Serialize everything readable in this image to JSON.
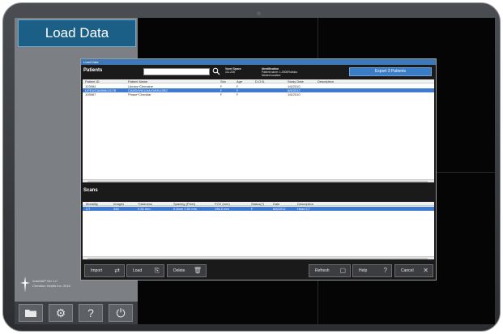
{
  "sidebar": {
    "title": "Load Data",
    "logo_text": [
      "AutoMAP Ver 1.0",
      "Chevillon Health Inc. 2016"
    ]
  },
  "dialog": {
    "title": "Load Data",
    "patients_title": "Patients",
    "search_value": "",
    "info_left": [
      "Voxel Space",
      "111-226"
    ],
    "info_right": [
      "Identification",
      "Patient name: 1-0000Roboko",
      "Nested location"
    ],
    "export_label": "Export 3 Patients",
    "patient_columns": [
      "Patient ID",
      "Patient Name",
      "Sex",
      "Age",
      "D.O.B.",
      "Study Date",
      "Description"
    ],
    "patients": [
      [
        "103984",
        "Library^Clemaine",
        "F",
        "F",
        "",
        "1/6/2010",
        ""
      ],
      [
        "LIFE4/CAM9/6/1/C78",
        "CAHD/9/6/1/AA/G/B91/3R2",
        "F",
        "F",
        "",
        "6/6/2012",
        ""
      ],
      [
        "105587",
        "Phase^Cheddar",
        "F",
        "F",
        "",
        "1/6/2010",
        ""
      ]
    ],
    "selected_patient": 1,
    "scans_title": "Scans",
    "scan_columns": [
      "Modality",
      "Images",
      "Thickness",
      "Spacing (Pixel)",
      "FOV (mm)",
      "Status(?)",
      "Date",
      "Description"
    ],
    "scans": [
      [
        "CT",
        "346",
        "0.50 mm",
        "0.5mm 0.50 mm",
        "196.0 mm",
        "F",
        "6/6/2012",
        "Head CT"
      ]
    ],
    "selected_scan": 0,
    "toolbar": {
      "import": "Import",
      "load": "Load",
      "delete": "Delete",
      "refresh": "Refresh",
      "help": "Help",
      "cancel": "Cancel"
    }
  },
  "colors": {
    "accent": "#1b5f86",
    "selection": "#3d7ad0",
    "export_button": "#3a7cc6"
  },
  "icons": {
    "sidebar_tools": [
      "folder-icon",
      "gear-icon",
      "help-icon",
      "power-icon"
    ]
  }
}
